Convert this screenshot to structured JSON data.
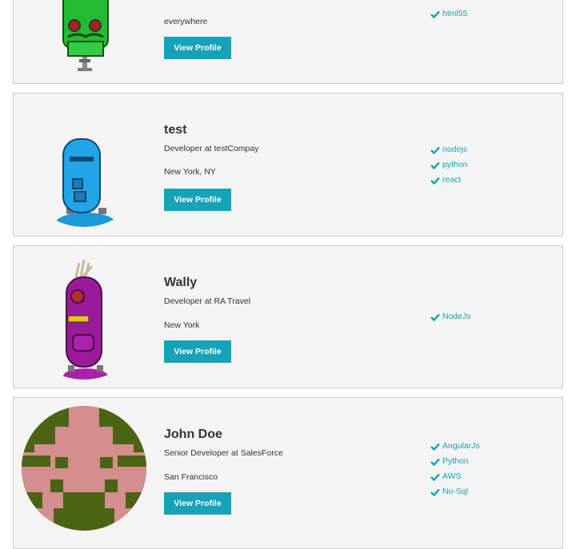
{
  "theme": {
    "primary": "#17a2b8",
    "card_bg": "#f4f4f4",
    "card_border": "#cccccc"
  },
  "profiles": [
    {
      "name": "",
      "status": "",
      "location": "everywhere",
      "button_label": "View Profile",
      "avatar": "green-robot-avatar",
      "skills": [
        "html55"
      ]
    },
    {
      "name": "test",
      "status": "Developer at testCompay",
      "location": "New York, NY",
      "button_label": "View Profile",
      "avatar": "blue-robot-avatar",
      "skills": [
        "nodejs",
        "python",
        "react"
      ]
    },
    {
      "name": "Wally",
      "status": "Developer at RA Travel",
      "location": "New York",
      "button_label": "View Profile",
      "avatar": "purple-robot-avatar",
      "skills": [
        "NodeJs"
      ]
    },
    {
      "name": "John Doe",
      "status": "Senior Developer at SalesForce",
      "location": "San Francisco",
      "button_label": "View Profile",
      "avatar": "pixel-invader-avatar",
      "skills": [
        "AngularJs",
        "Python",
        "AWS",
        "No-Sql"
      ]
    }
  ]
}
